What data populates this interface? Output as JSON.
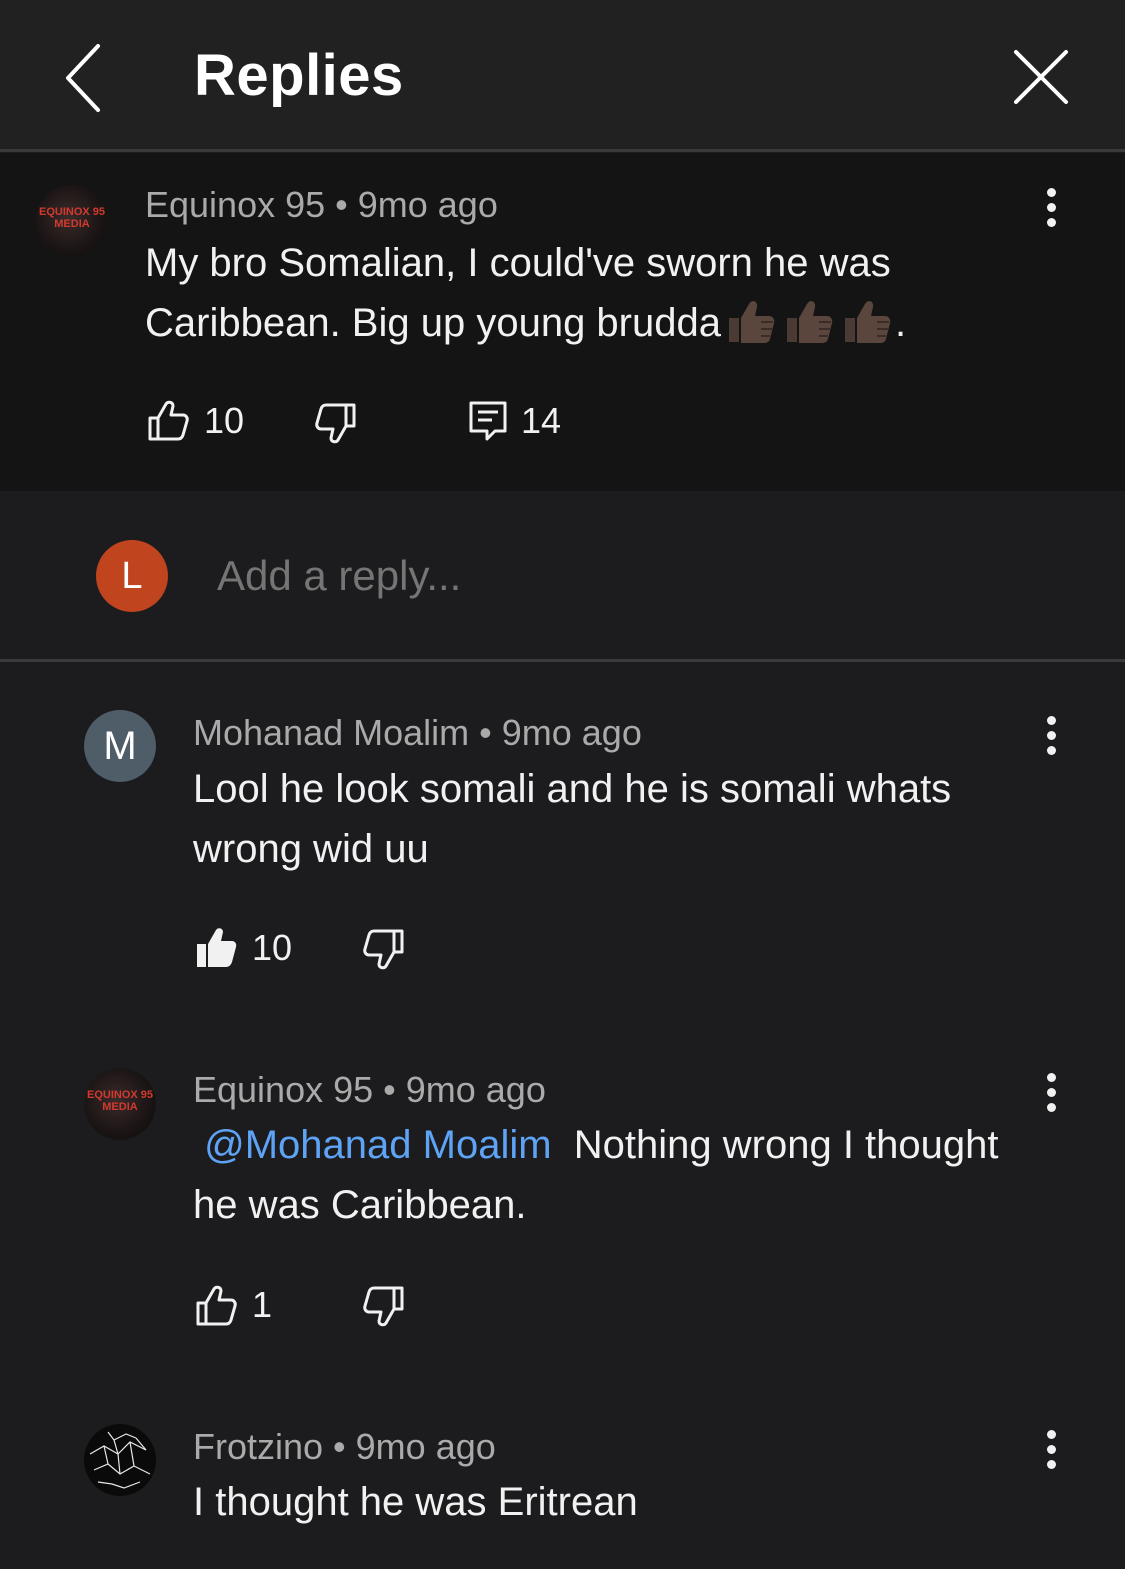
{
  "header": {
    "title": "Replies"
  },
  "parent_comment": {
    "avatar_text": "EQUINOX 95 MEDIA",
    "author": "Equinox 95",
    "time": "9mo ago",
    "text_line1": "My bro Somalian, I could've sworn he was",
    "text_line2_prefix": "Caribbean. Big up young brudda",
    "text_line2_suffix": ".",
    "likes": "10",
    "replies": "14"
  },
  "reply_box": {
    "user_initial": "L",
    "placeholder": "Add a reply..."
  },
  "replies": [
    {
      "avatar_text": "M",
      "author": "Mohanad Moalim",
      "time": "9mo ago",
      "text_line1": "Lool he look somali and he is somali whats",
      "text_line2": "wrong wid uu",
      "likes": "10",
      "liked": true
    },
    {
      "avatar_text": "EQUINOX 95 MEDIA",
      "author": "Equinox 95",
      "time": "9mo ago",
      "mention": "@Mohanad Moalim",
      "text_line1": "Nothing wrong I thought",
      "text_line2": "he was Caribbean.",
      "likes": "1",
      "liked": false
    },
    {
      "author": "Frotzino",
      "time": "9mo ago",
      "text_line1": "I thought he was Eritrean"
    }
  ],
  "colors": {
    "background": "#1c1c1e",
    "header": "#212121",
    "parent_bg": "#141414",
    "mention": "#5ea3f5",
    "user_avatar": "#c0451f"
  }
}
